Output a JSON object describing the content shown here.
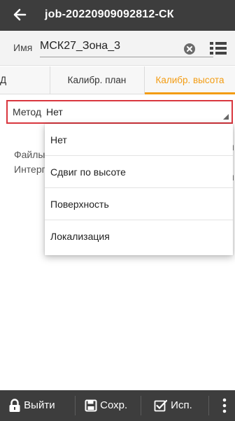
{
  "header": {
    "title": "job-20220909092812-СК",
    "back_icon": "arrow-left-icon"
  },
  "name_field": {
    "label": "Имя",
    "value": "МСК27_Зона_3",
    "clear_icon": "clear-circle-icon",
    "list_icon": "list-icon"
  },
  "tabs": [
    {
      "label": "Д"
    },
    {
      "label": "Калибр. план"
    },
    {
      "label": "Калибр. высота",
      "active": true
    }
  ],
  "method": {
    "label": "Метод",
    "value": "Нет"
  },
  "fields": {
    "files_label": "Файлы",
    "interp_label": "Интерп"
  },
  "dropdown": {
    "options": [
      "Нет",
      "Сдвиг по высоте",
      "Поверхность",
      "Локализация"
    ]
  },
  "bottom": {
    "exit_label": "Выйти",
    "save_label": "Сохр.",
    "apply_label": "Исп.",
    "more_icon": "more-vertical-icon"
  },
  "colors": {
    "bar": "#3d3d3d",
    "accent": "#f39c12",
    "highlight_border": "#d9363e"
  }
}
